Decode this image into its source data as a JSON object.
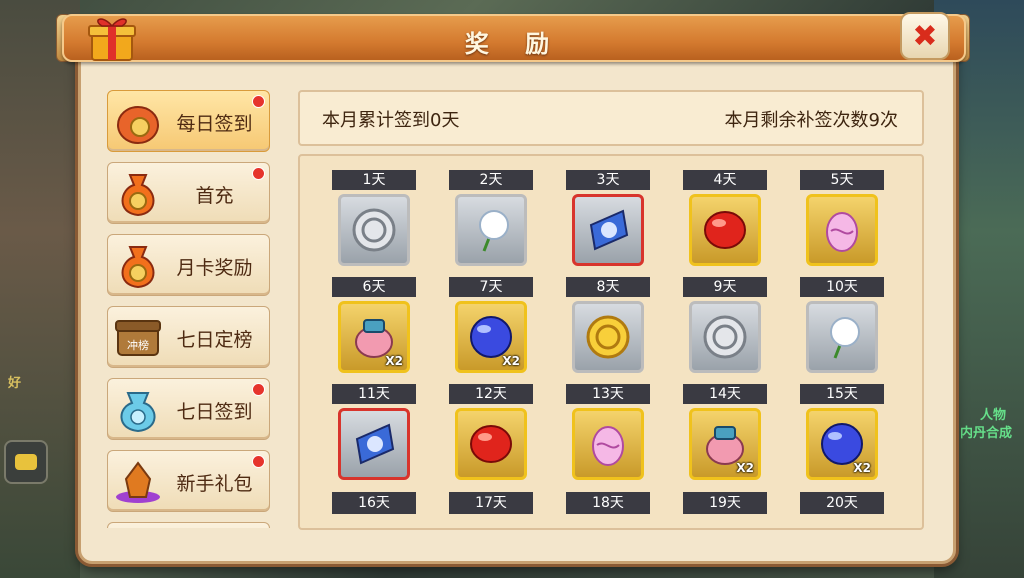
{
  "window": {
    "title": "奖 励"
  },
  "menu": {
    "items": [
      {
        "label": "每日签到",
        "icon": "coin-pouch-icon",
        "active": true,
        "dot": true
      },
      {
        "label": "首充",
        "icon": "money-bag-icon",
        "active": false,
        "dot": true
      },
      {
        "label": "月卡奖励",
        "icon": "money-bag-icon",
        "active": false,
        "dot": false
      },
      {
        "label": "七日定榜",
        "icon": "rank-chest-icon",
        "active": false,
        "dot": false,
        "icon_text": "冲榜"
      },
      {
        "label": "七日签到",
        "icon": "blue-bag-icon",
        "active": false,
        "dot": true
      },
      {
        "label": "新手礼包",
        "icon": "crystal-gift-icon",
        "active": false,
        "dot": true
      }
    ]
  },
  "stats": {
    "left": "本月累计签到0天",
    "right": "本月剩余补签次数9次"
  },
  "rewards": [
    {
      "day": "1天",
      "item": "silver-coin-icon",
      "frame": "gray",
      "qty": ""
    },
    {
      "day": "2天",
      "item": "dandelion-icon",
      "frame": "gray",
      "qty": ""
    },
    {
      "day": "3天",
      "item": "blue-talisman-icon",
      "frame": "red",
      "qty": ""
    },
    {
      "day": "4天",
      "item": "red-gem-icon",
      "frame": "gold",
      "qty": ""
    },
    {
      "day": "5天",
      "item": "pink-egg-icon",
      "frame": "gold",
      "qty": ""
    },
    {
      "day": "6天",
      "item": "pet-bag-icon",
      "frame": "gold",
      "qty": "X2"
    },
    {
      "day": "7天",
      "item": "blue-orb-icon",
      "frame": "gold",
      "qty": "X2"
    },
    {
      "day": "8天",
      "item": "gold-coin-icon",
      "frame": "gray",
      "qty": ""
    },
    {
      "day": "9天",
      "item": "silver-coin-icon",
      "frame": "gray",
      "qty": ""
    },
    {
      "day": "10天",
      "item": "dandelion-icon",
      "frame": "gray",
      "qty": ""
    },
    {
      "day": "11天",
      "item": "blue-talisman-icon",
      "frame": "red",
      "qty": ""
    },
    {
      "day": "12天",
      "item": "red-gem-icon",
      "frame": "gold",
      "qty": ""
    },
    {
      "day": "13天",
      "item": "pink-egg-icon",
      "frame": "gold",
      "qty": ""
    },
    {
      "day": "14天",
      "item": "pet-bag-icon",
      "frame": "gold",
      "qty": "X2"
    },
    {
      "day": "15天",
      "item": "blue-orb-icon",
      "frame": "gold",
      "qty": "X2"
    }
  ],
  "next_row_days": [
    "16天",
    "17天",
    "18天",
    "19天",
    "20天"
  ],
  "background_text": {
    "left_1": "好",
    "right_1": "人物",
    "right_2": "内丹合成"
  },
  "colors": {
    "accent": "#d47a2f",
    "day_label_bg": "#3a3a42",
    "gold_frame": "#f0c21c",
    "red_frame": "#d8342c",
    "dot": "#e6342c"
  }
}
